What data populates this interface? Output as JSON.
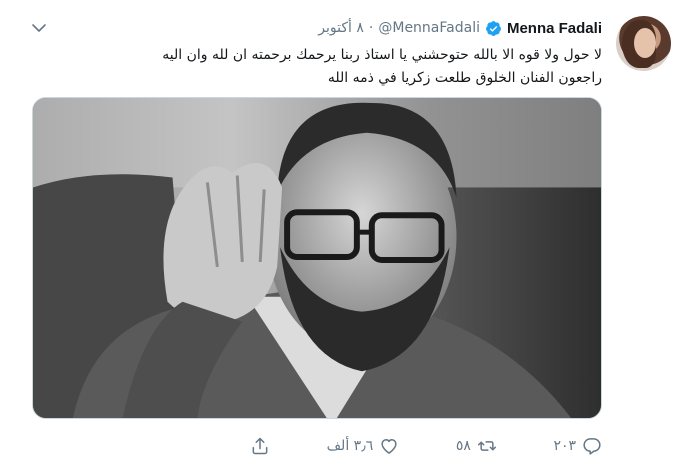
{
  "tweet": {
    "author": {
      "name": "Menna Fadali",
      "handle": "@MennaFadali",
      "verified": true
    },
    "separator": "·",
    "date": "٨ أكتوبر",
    "text_lines": [
      "لا حول ولا قوه الا بالله حتوحشني يا استاذ ربنا يرحمك برحمته ان لله وان اليه",
      "راجعون الفنان الخلوق طلعت زكريا في ذمه الله"
    ],
    "actions": {
      "reply": {
        "icon": "reply-icon",
        "count": "٢٠٣"
      },
      "retweet": {
        "icon": "retweet-icon",
        "count": "٥٨"
      },
      "like": {
        "icon": "heart-icon",
        "count": "٣٫٦ ألف"
      },
      "share": {
        "icon": "share-icon",
        "count": ""
      }
    },
    "colors": {
      "verified": "#1da1f2",
      "secondary_text": "#657786",
      "primary_text": "#14171a"
    }
  }
}
